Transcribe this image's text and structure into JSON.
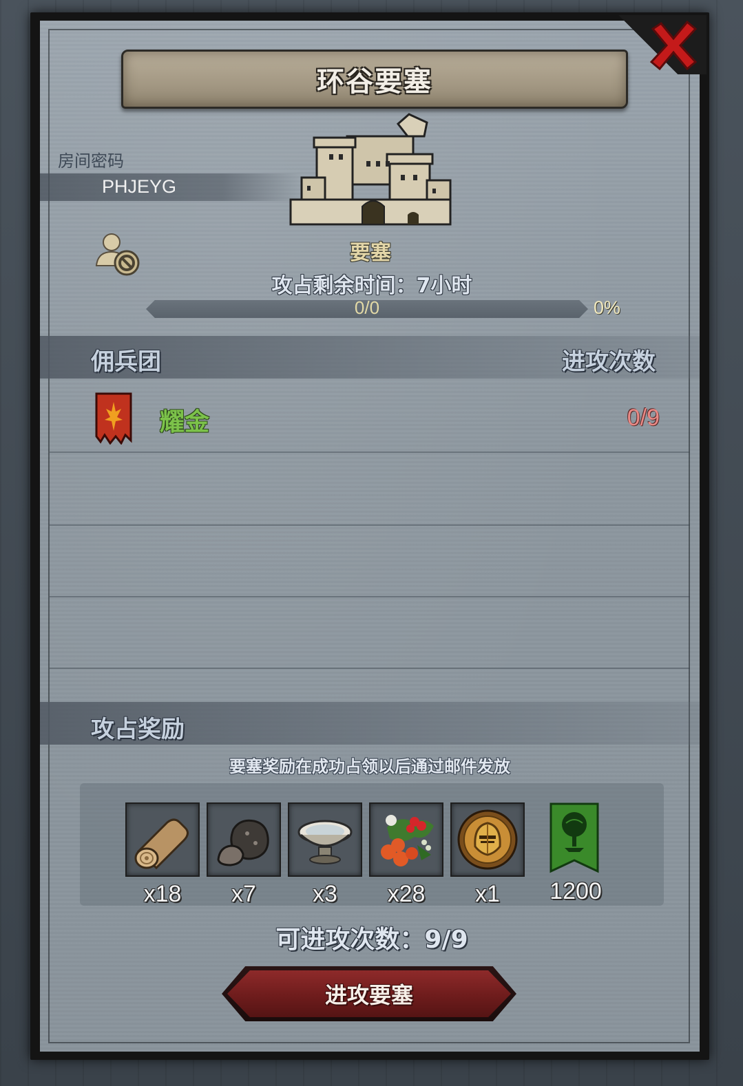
{
  "title": "环谷要塞",
  "room": {
    "label": "房间密码",
    "code": "PHJEYG"
  },
  "fortress": {
    "name": "要塞",
    "remaining_time": "攻占剩余时间：7小时",
    "progress_text": "0/0",
    "progress_percent_text": "0%",
    "progress_fraction": 0
  },
  "mercenary_section": {
    "title": "佣兵团",
    "attacks_header": "进攻次数",
    "rows": [
      {
        "name": "耀金",
        "attacks": "0/9",
        "banner_color": "#c0321e"
      }
    ]
  },
  "reward_section": {
    "title": "攻占奖励",
    "note": "要塞奖励在成功占领以后通过邮件发放",
    "items": [
      {
        "icon": "log-icon",
        "qty": "x18"
      },
      {
        "icon": "ore-icon",
        "qty": "x7"
      },
      {
        "icon": "bowl-icon",
        "qty": "x3"
      },
      {
        "icon": "berries-icon",
        "qty": "x28"
      },
      {
        "icon": "knight-helmet-coin-icon",
        "qty": "x1"
      },
      {
        "icon": "green-tree-banner-icon",
        "qty": "1200"
      }
    ]
  },
  "attacks_left": "可进攻次数：9/9",
  "attack_button": "进攻要塞",
  "colors": {
    "merc_name": "#7cc24a",
    "merc_attacks": "#e98a86",
    "button": "#7a2222",
    "close_x": "#c41a1a"
  }
}
